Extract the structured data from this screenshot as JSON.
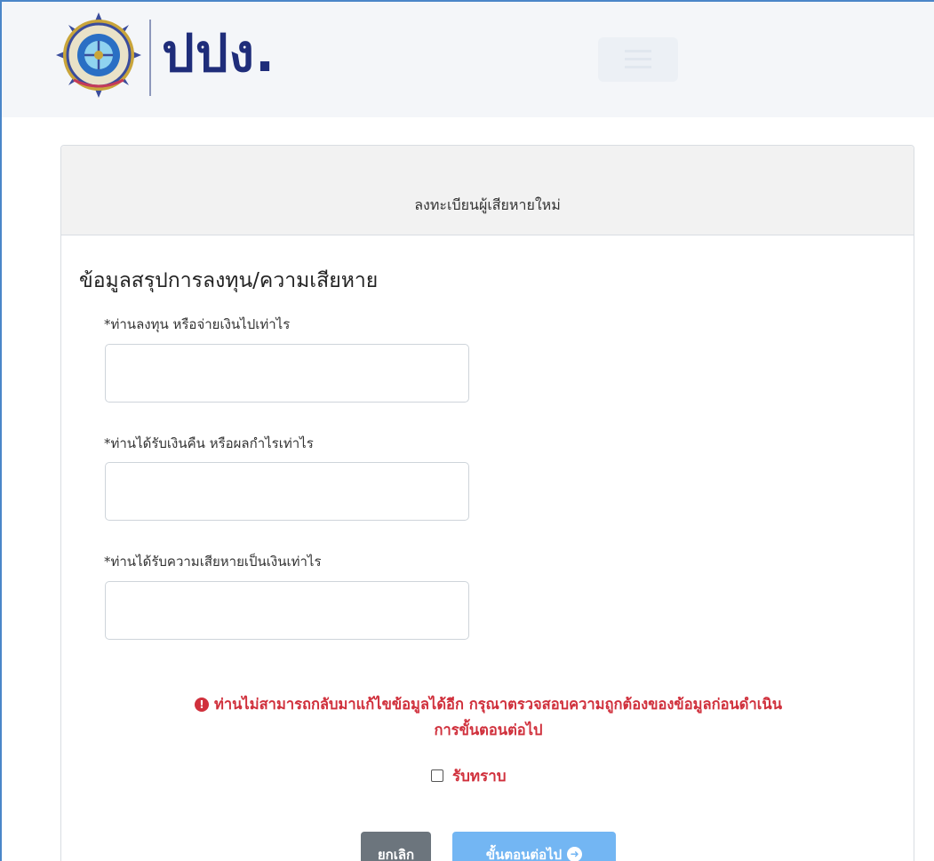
{
  "header": {
    "brand": "ปปง.",
    "logo_icon": "seal-logo-icon",
    "menu_icon": "hamburger-menu-icon"
  },
  "card": {
    "title": "ลงทะเบียนผู้เสียหายใหม่"
  },
  "form": {
    "section_title": "ข้อมูลสรุปการลงทุน/ความเสียหาย",
    "fields": [
      {
        "label": "*ท่านลงทุน หรือจ่ายเงินไปเท่าไร",
        "value": "",
        "placeholder": ""
      },
      {
        "label": "*ท่านได้รับเงินคืน หรือผลกำไรเท่าไร",
        "value": "",
        "placeholder": ""
      },
      {
        "label": "*ท่านได้รับความเสียหายเป็นเงินเท่าไร",
        "value": "",
        "placeholder": ""
      }
    ]
  },
  "warning": {
    "icon": "exclamation-circle-icon",
    "line1": "ท่านไม่สามารถกลับมาแก้ไขข้อมูลได้อีก กรุณาตรวจสอบความถูกต้องของข้อมูลก่อนดำเนิน",
    "line2": "การขั้นตอนต่อไป"
  },
  "acknowledge": {
    "label": "รับทราบ",
    "checked": false
  },
  "buttons": {
    "cancel_label": "ยกเลิก",
    "next_label": "ขั้นตอนต่อไป",
    "next_icon": "arrow-circle-right-icon"
  },
  "colors": {
    "brand": "#1f2d7a",
    "warning": "#d0303c",
    "cancel_button": "#6c757d",
    "next_button": "#73b6f3"
  }
}
